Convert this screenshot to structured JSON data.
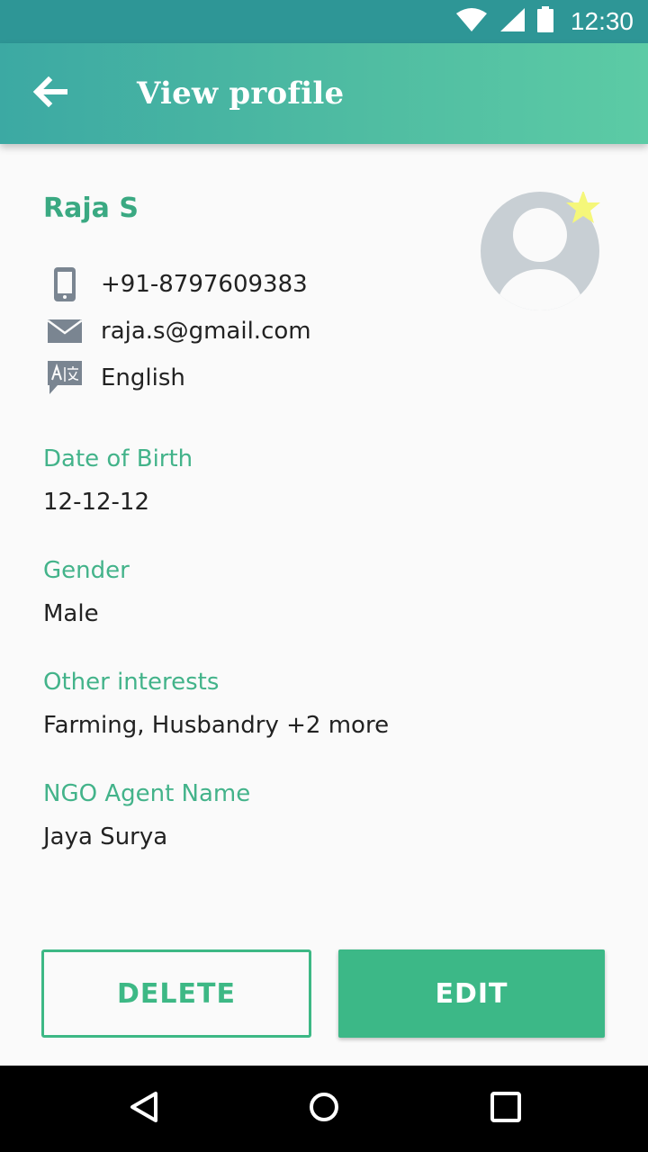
{
  "status_bar": {
    "time": "12:30",
    "icons": [
      "wifi-icon",
      "cellular-signal-icon",
      "battery-icon"
    ]
  },
  "app_bar": {
    "title": "View profile",
    "back_icon": "arrow-back-icon"
  },
  "profile": {
    "name": "Raja S",
    "phone": "+91-8797609383",
    "email": "raja.s@gmail.com",
    "language": "English",
    "avatar_icon": "avatar-placeholder-icon",
    "badge_icon": "star-icon"
  },
  "fields": [
    {
      "label": "Date of Birth",
      "value": "12-12-12"
    },
    {
      "label": "Gender",
      "value": "Male"
    },
    {
      "label": "Other interests",
      "value": "Farming, Husbandry +2 more"
    },
    {
      "label": "NGO Agent Name",
      "value": "Jaya Surya"
    }
  ],
  "actions": {
    "delete_label": "DELETE",
    "edit_label": "EDIT"
  },
  "nav_bar": {
    "icons": [
      "nav-back-icon",
      "nav-home-icon",
      "nav-recents-icon"
    ]
  },
  "colors": {
    "accent": "#3cb887",
    "status_bar": "#2e9696",
    "app_bar_start": "#3ca9a3",
    "app_bar_end": "#5ccba5",
    "star": "#f5f77a",
    "avatar": "#c8cfd4"
  }
}
